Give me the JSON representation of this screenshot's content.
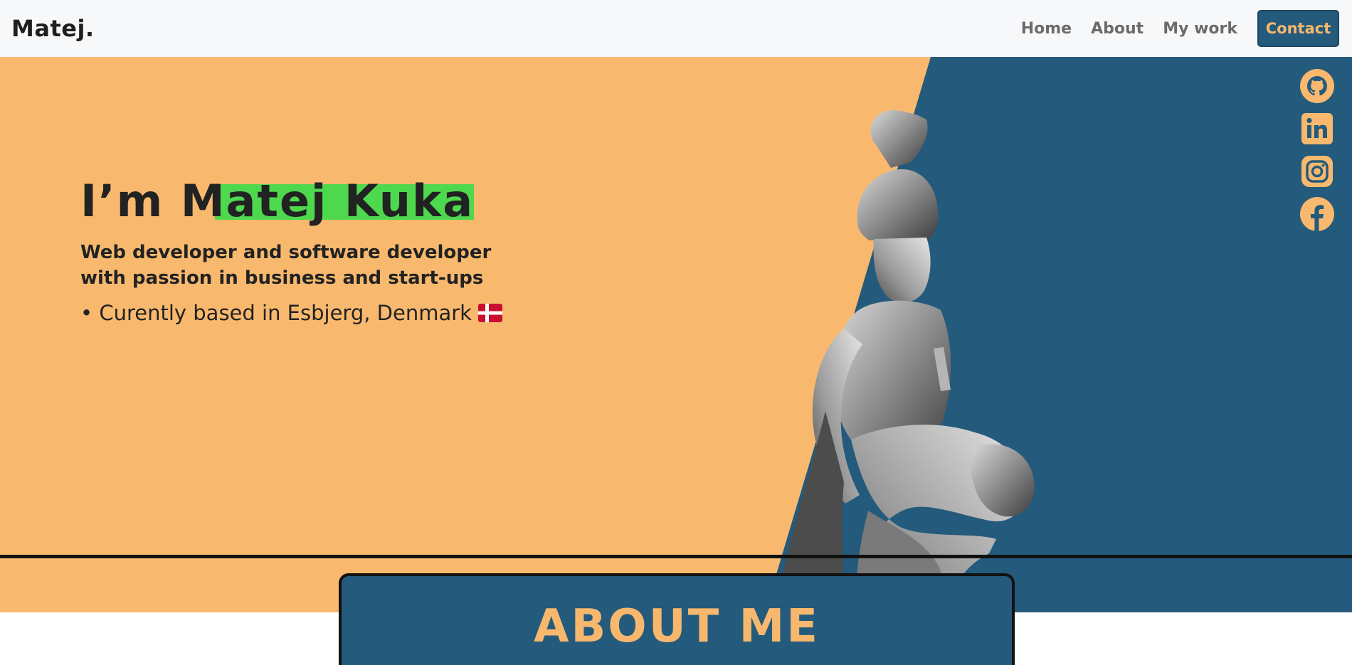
{
  "brand": "Matej.",
  "nav": {
    "items": [
      "Home",
      "About",
      "My work"
    ],
    "contact": "Contact"
  },
  "hero": {
    "title_prefix": "I’m ",
    "title_name": "Matej Kuka",
    "subtitle": "Web developer and software developer with passion in business and start-ups",
    "location": "• Curently based in Esbjerg, Denmark"
  },
  "social": [
    "github-icon",
    "linkedin-icon",
    "instagram-icon",
    "facebook-icon"
  ],
  "about": {
    "title": "ABOUT ME"
  },
  "colors": {
    "orange": "#f8b96e",
    "blue": "#245a7c",
    "highlight": "#4ed84e",
    "dark": "#222222"
  }
}
